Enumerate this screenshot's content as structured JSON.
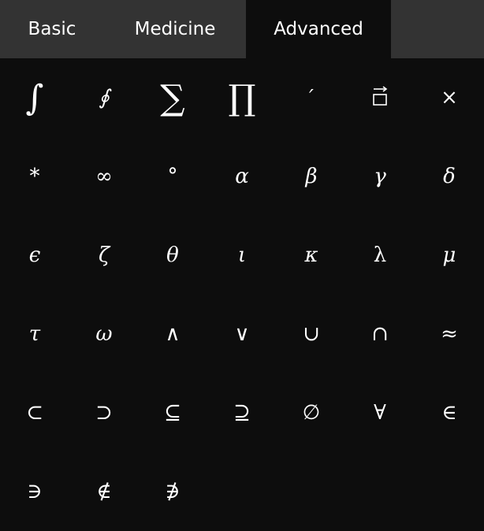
{
  "tabs": [
    {
      "id": "basic",
      "label": "Basic",
      "active": false
    },
    {
      "id": "medicine",
      "label": "Medicine",
      "active": false
    },
    {
      "id": "advanced",
      "label": "Advanced",
      "active": true
    }
  ],
  "symbols": [
    [
      "∫",
      "∮",
      "∑",
      "∏",
      "′",
      "⃗",
      "×"
    ],
    [
      "*",
      "∞",
      "°",
      "α",
      "β",
      "γ",
      "δ"
    ],
    [
      "ϵ",
      "ζ",
      "θ",
      "ι",
      "κ",
      "λ",
      "μ"
    ],
    [
      "τ",
      "ω",
      "∧",
      "∨",
      "∪",
      "∩",
      "≈"
    ],
    [
      "⊂",
      "⊃",
      "⊆",
      "⊇",
      "∅",
      "∀",
      "∈"
    ],
    [
      "∋",
      "∉",
      "∌"
    ]
  ],
  "colors": {
    "background": "#0d0d0d",
    "tab_inactive": "#333333",
    "text": "#ffffff"
  }
}
